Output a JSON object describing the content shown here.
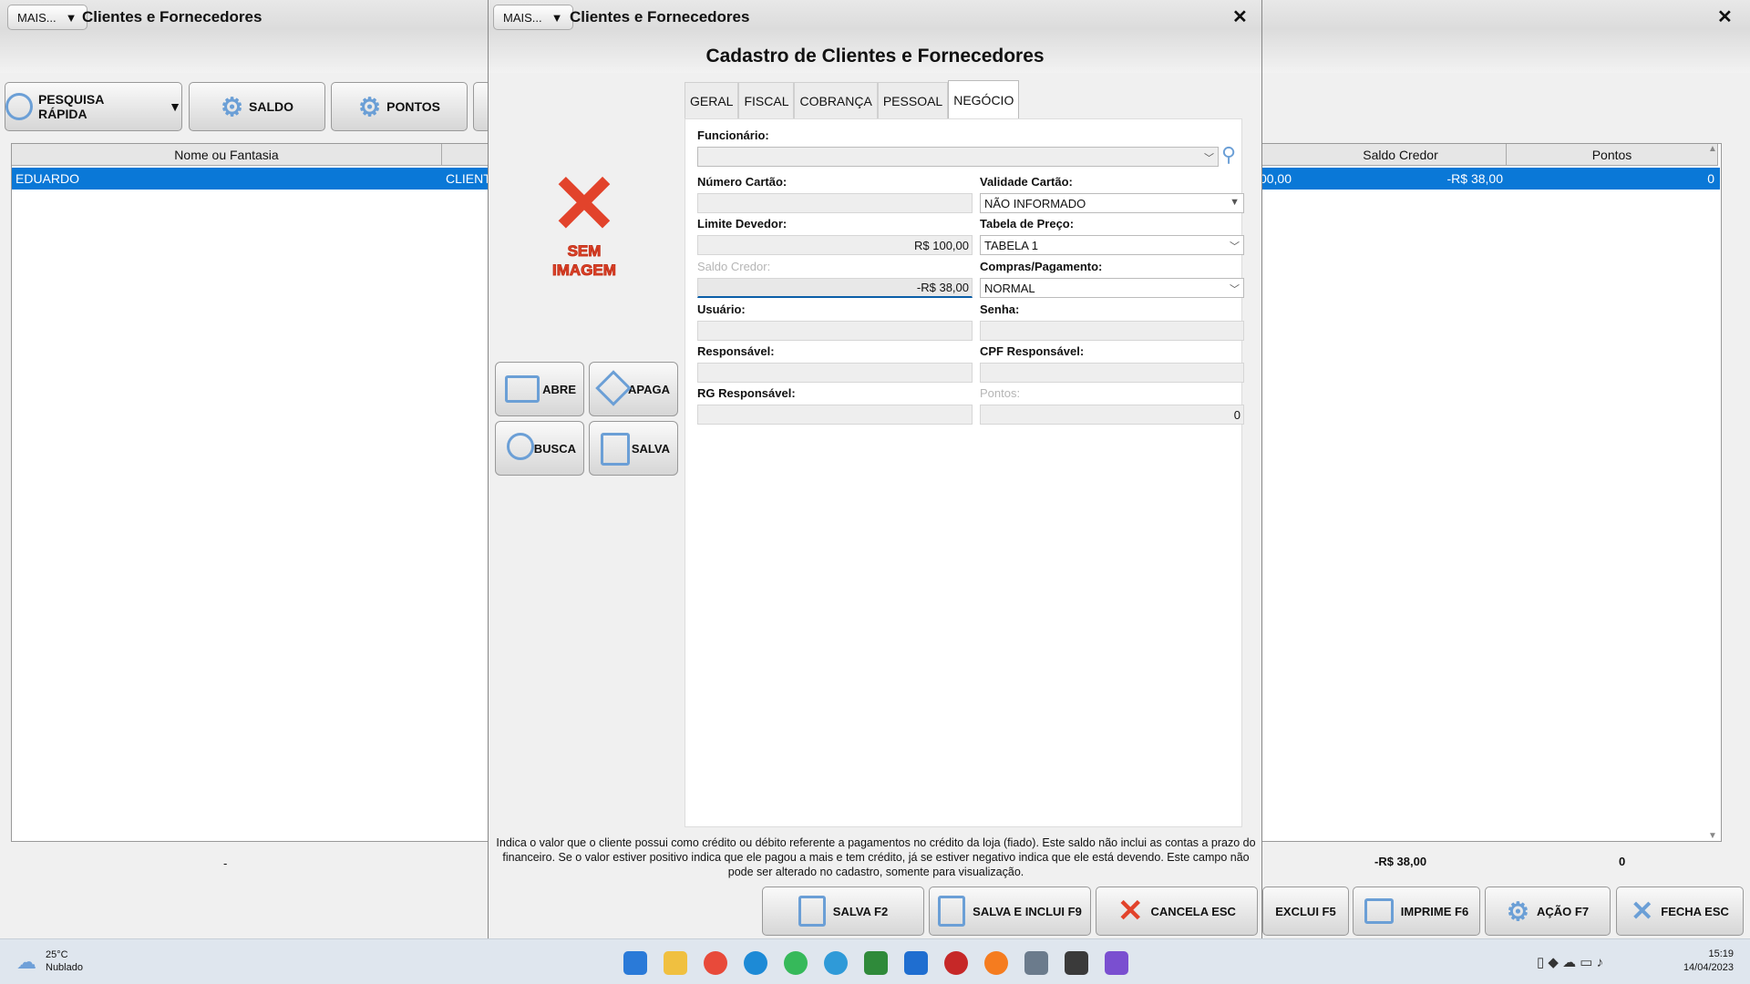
{
  "background_window": {
    "mais_label": "MAIS...",
    "title": "Clientes e Fornecedores",
    "toolbar": {
      "pesquisa_rapida": "PESQUISA RÁPIDA",
      "saldo": "SALDO",
      "pontos": "PONTOS"
    },
    "grid": {
      "headers": [
        "Nome ou Fantasia",
        "Saldo Credor",
        "Pontos"
      ],
      "row": {
        "nome": "EDUARDO",
        "tipo": "CLIENTE",
        "partial_value": "00,00",
        "saldo_credor": "-R$ 38,00",
        "pontos": "0"
      }
    },
    "totals": {
      "left": "-",
      "saldo_credor": "-R$ 38,00",
      "pontos": "0"
    },
    "bottom_buttons": {
      "exclui": "EXCLUI F5",
      "imprime": "IMPRIME F6",
      "acao": "AÇÃO F7",
      "fecha": "FECHA ESC"
    }
  },
  "modal": {
    "mais_label": "MAIS...",
    "window_title": "Clientes e Fornecedores",
    "heading": "Cadastro de Clientes e Fornecedores",
    "no_image_text": [
      "SEM",
      "IMAGEM"
    ],
    "side_buttons": {
      "abre": "ABRE",
      "apaga": "APAGA",
      "busca": "BUSCA",
      "salva": "SALVA"
    },
    "tabs": [
      "GERAL",
      "FISCAL",
      "COBRANÇA",
      "PESSOAL",
      "NEGÓCIO"
    ],
    "active_tab": "NEGÓCIO",
    "form": {
      "funcionario_label": "Funcionário:",
      "funcionario_value": "",
      "numero_cartao_label": "Número Cartão:",
      "numero_cartao_value": "",
      "validade_cartao_label": "Validade Cartão:",
      "validade_cartao_value": "NÃO INFORMADO",
      "limite_devedor_label": "Limite Devedor:",
      "limite_devedor_value": "R$ 100,00",
      "tabela_preco_label": "Tabela de Preço:",
      "tabela_preco_value": "TABELA 1",
      "saldo_credor_label": "Saldo Credor:",
      "saldo_credor_value": "-R$ 38,00",
      "compras_pagamento_label": "Compras/Pagamento:",
      "compras_pagamento_value": "NORMAL",
      "usuario_label": "Usuário:",
      "usuario_value": "",
      "senha_label": "Senha:",
      "senha_value": "",
      "responsavel_label": "Responsável:",
      "responsavel_value": "",
      "cpf_responsavel_label": "CPF Responsável:",
      "cpf_responsavel_value": "",
      "rg_responsavel_label": "RG Responsável:",
      "rg_responsavel_value": "",
      "pontos_label": "Pontos:",
      "pontos_value": "0"
    },
    "hint": "Indica o valor que o cliente possui como crédito ou débito referente a pagamentos no crédito da loja (fiado). Este saldo não inclui as contas a prazo do financeiro. Se o valor estiver positivo indica que ele pagou a mais e tem crédito, já se estiver negativo indica que ele está devendo. Este campo não pode ser alterado no cadastro, somente para visualização.",
    "buttons": {
      "salva": "SALVA F2",
      "salva_inclui": "SALVA E INCLUI F9",
      "cancela": "CANCELA ESC"
    }
  },
  "taskbar": {
    "weather_temp": "25°C",
    "weather_desc": "Nublado",
    "time": "15:19",
    "date": "14/04/2023"
  },
  "colors": {
    "selection": "#0a78d7",
    "danger": "#e2432b",
    "icon_blue": "#6b9fd6"
  }
}
